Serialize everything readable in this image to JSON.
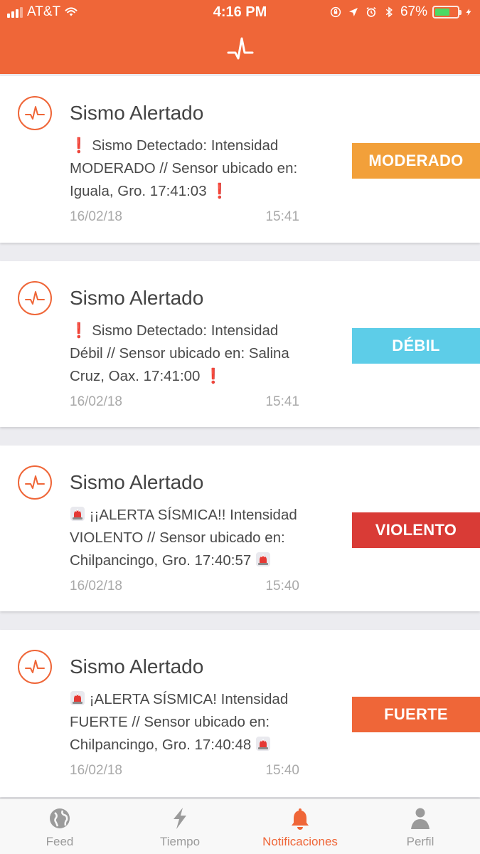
{
  "status_bar": {
    "carrier": "AT&T",
    "time": "4:16 PM",
    "battery": "67%"
  },
  "header": {
    "logo_icon": "seismograph-pulse-icon"
  },
  "colors": {
    "brand": "#ef6638",
    "moderado": "#f2a03a",
    "debil": "#5dcde8",
    "violento": "#d93b36",
    "fuerte": "#ef6638"
  },
  "notifications": [
    {
      "title": "Sismo Alertado",
      "lines": [
        "❗ Sismo Detectado: Intensidad",
        "MODERADO // Sensor ubicado en:",
        "Iguala, Gro. 17:41:03 ❗"
      ],
      "date": "16/02/18",
      "time": "15:41",
      "level": "MODERADO"
    },
    {
      "title": "Sismo Alertado",
      "lines": [
        "❗ Sismo Detectado: Intensidad",
        "Débil // Sensor ubicado en: Salina",
        "Cruz, Oax. 17:41:00 ❗"
      ],
      "date": "16/02/18",
      "time": "15:41",
      "level": "DÉBIL"
    },
    {
      "title": "Sismo Alertado",
      "lines": [
        "🚨 ¡¡ALERTA SÍSMICA!! Intensidad",
        "VIOLENTO // Sensor ubicado en:",
        "Chilpancingo, Gro. 17:40:57 🚨"
      ],
      "date": "16/02/18",
      "time": "15:40",
      "level": "VIOLENTO"
    },
    {
      "title": "Sismo Alertado",
      "lines": [
        "🚨 ¡ALERTA SÍSMICA! Intensidad",
        "FUERTE // Sensor ubicado en:",
        "Chilpancingo, Gro. 17:40:48 🚨"
      ],
      "date": "16/02/18",
      "time": "15:40",
      "level": "FUERTE"
    }
  ],
  "tabs": [
    {
      "label": "Feed",
      "icon": "globe-icon"
    },
    {
      "label": "Tiempo",
      "icon": "lightning-icon"
    },
    {
      "label": "Notificaciones",
      "icon": "bell-icon",
      "active": true
    },
    {
      "label": "Perfil",
      "icon": "person-icon"
    }
  ]
}
